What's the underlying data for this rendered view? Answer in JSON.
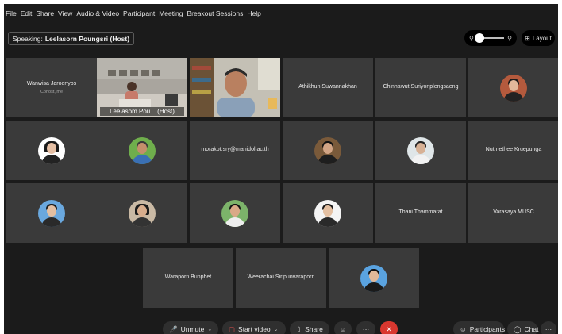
{
  "menubar": [
    "File",
    "Edit",
    "Share",
    "View",
    "Audio & Video",
    "Participant",
    "Meeting",
    "Breakout Sessions",
    "Help"
  ],
  "speaking": {
    "prefix": "Speaking:",
    "name": "Leelasorn Poungsri (Host)"
  },
  "zoom": {
    "level": 0.1
  },
  "layout_label": "Layout",
  "tiles": {
    "t1": {
      "name": "Wanwisa Jaroenyos",
      "sub": "Cohost, me"
    },
    "t2": {
      "label": "Leelasom Pou... (Host)"
    },
    "t4": {
      "name": "Athikhun Suwannakhan"
    },
    "t5": {
      "name": "Chinnawut Suriyonplengsaeng"
    },
    "t9": {
      "name": "morakot.sry@mahidol.ac.th"
    },
    "t12": {
      "name": "Nutmethee Kruepunga"
    },
    "t17": {
      "name": "Thani Thammarat"
    },
    "t18": {
      "name": "Varasaya MUSC"
    },
    "t19": {
      "name": "Waraporn Bunphet"
    },
    "t20": {
      "name": "Weerachai Siripunvaraporn"
    }
  },
  "toolbar": {
    "unmute": "Unmute",
    "start_video": "Start video",
    "share": "Share",
    "more": "···",
    "leave": "✕",
    "participants": "Participants",
    "chat": "Chat",
    "overflow": "···"
  },
  "colors": {
    "active_border": "#3fa9f5",
    "leave": "#d9372f",
    "tile": "#3a3a3a"
  }
}
